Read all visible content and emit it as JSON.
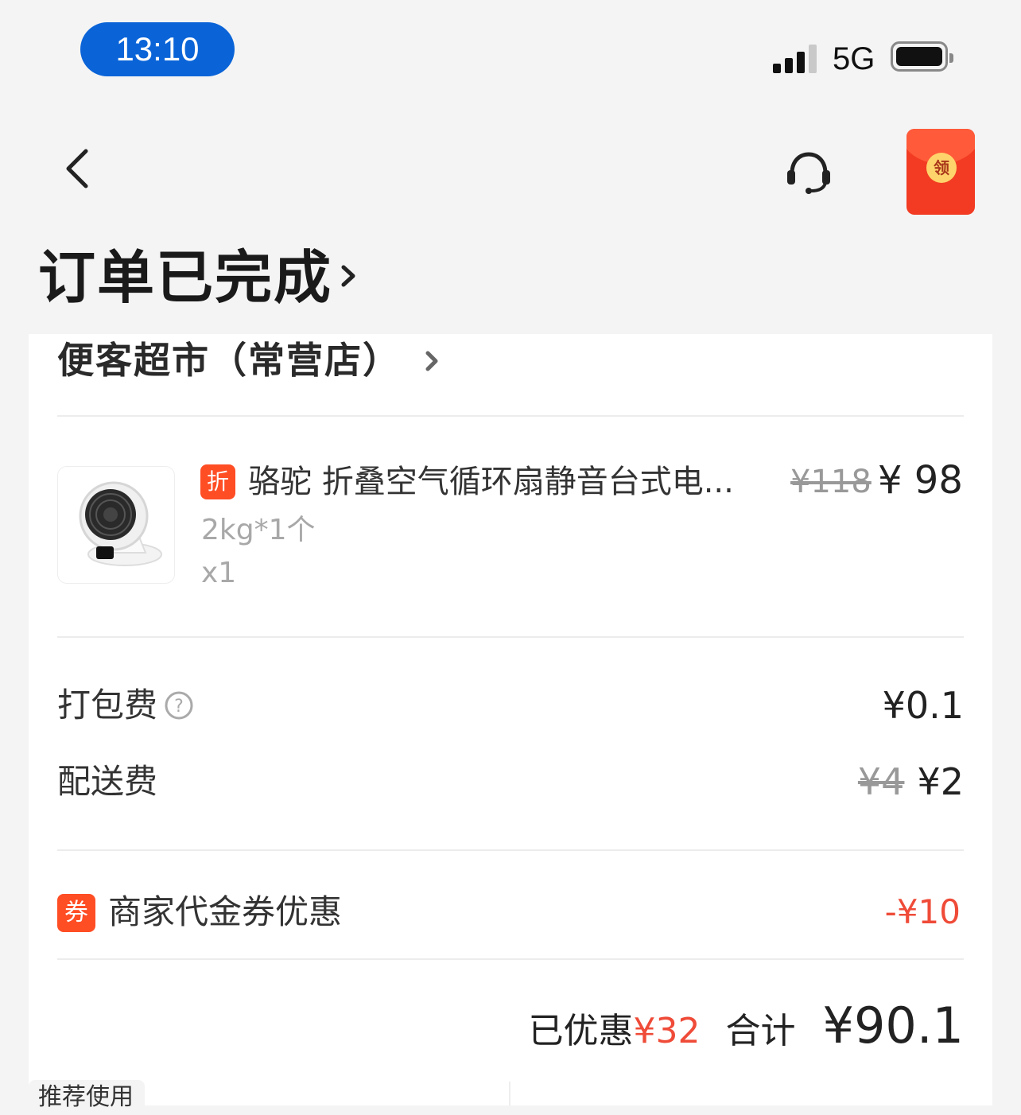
{
  "status_bar": {
    "time": "13:10",
    "network": "5G"
  },
  "nav": {
    "reward_icon_text": "领"
  },
  "order": {
    "status_title": "订单已完成"
  },
  "store": {
    "name": "便客超市（常营店）"
  },
  "product": {
    "badge": "折",
    "name": "骆驼 折叠空气循环扇静音台式电...",
    "original_price": "¥118",
    "price": "¥ 98",
    "spec": "2kg*1个",
    "quantity": "x1"
  },
  "fees": {
    "packing_label": "打包费",
    "packing_value": "¥0.1",
    "delivery_label": "配送费",
    "delivery_original": "¥4",
    "delivery_value": "¥2"
  },
  "coupon": {
    "badge": "券",
    "label": "商家代金券优惠",
    "amount": "-¥10"
  },
  "summary": {
    "discount_label": "已优惠",
    "discount_value": "¥32",
    "total_label": "合计",
    "total_value": "¥90.1"
  },
  "bottom": {
    "recommend_tab": "推荐使用"
  },
  "colors": {
    "accent": "#ef4b38",
    "time_pill": "#0a64d8",
    "badge": "#ff4d24"
  }
}
